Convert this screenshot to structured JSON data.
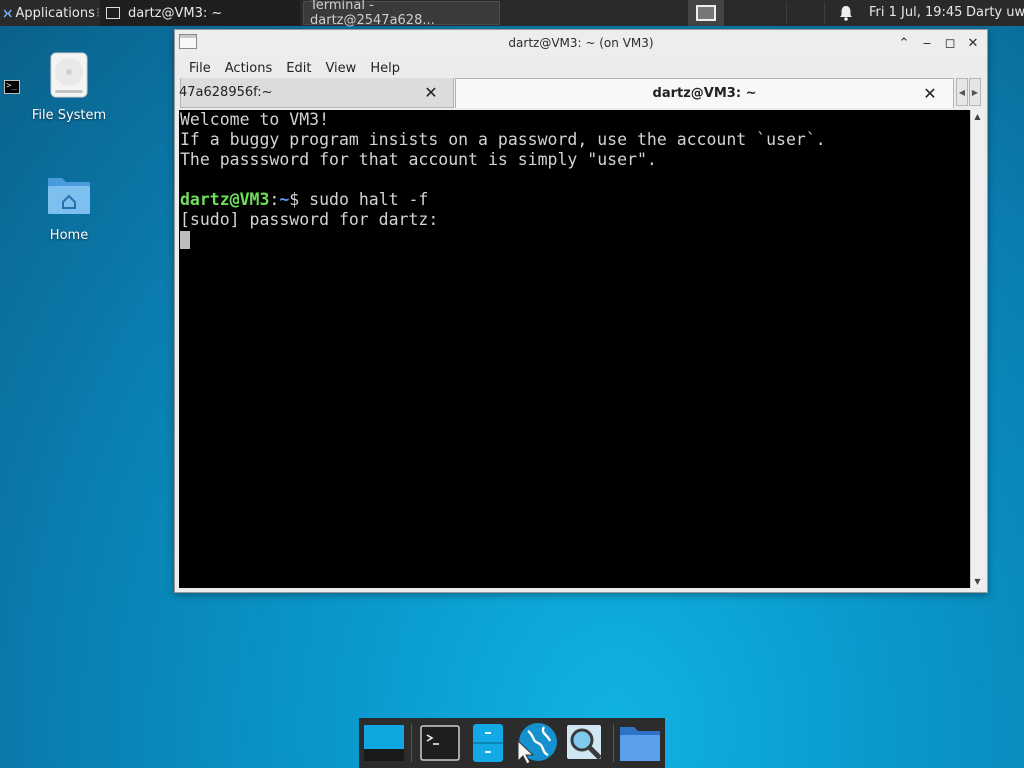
{
  "top_panel": {
    "applications_label": "Applications",
    "tasks": [
      {
        "label": "dartz@VM3: ~",
        "icon": "window-icon"
      },
      {
        "label": "Terminal - dartz@2547a628...",
        "icon": "terminal-icon"
      }
    ],
    "clock": "Fri  1 Jul, 19:45",
    "user": "Darty uwu"
  },
  "desktop": {
    "icons": [
      {
        "label": "File System",
        "icon": "drive-icon"
      },
      {
        "label": "Home",
        "icon": "home-folder-icon"
      }
    ]
  },
  "window": {
    "title": "dartz@VM3: ~ (on VM3)",
    "menu": [
      "File",
      "Actions",
      "Edit",
      "View",
      "Help"
    ],
    "tabs": [
      {
        "label": "47a628956f:~",
        "active": false
      },
      {
        "label": "dartz@VM3: ~",
        "active": true
      }
    ]
  },
  "terminal": {
    "motd_1": "Welcome to VM3!",
    "motd_2": "If a buggy program insists on a password, use the account `user`.",
    "motd_3": "The passsword for that account is simply \"user\".",
    "prompt_user": "dartz@VM3",
    "prompt_colon": ":",
    "prompt_path": "~",
    "prompt_symbol": "$ ",
    "command": "sudo halt -f",
    "sudo_prompt": "[sudo] password for dartz:"
  },
  "dock": {
    "items": [
      "show-desktop-icon",
      "terminal-icon",
      "file-manager-icon",
      "web-browser-icon",
      "app-finder-icon",
      "folder-icon"
    ]
  },
  "colors": {
    "prompt_user": "#6fde5a",
    "prompt_path": "#5b9bef",
    "terminal_bg": "#000000",
    "terminal_fg": "#d3d3d3"
  }
}
